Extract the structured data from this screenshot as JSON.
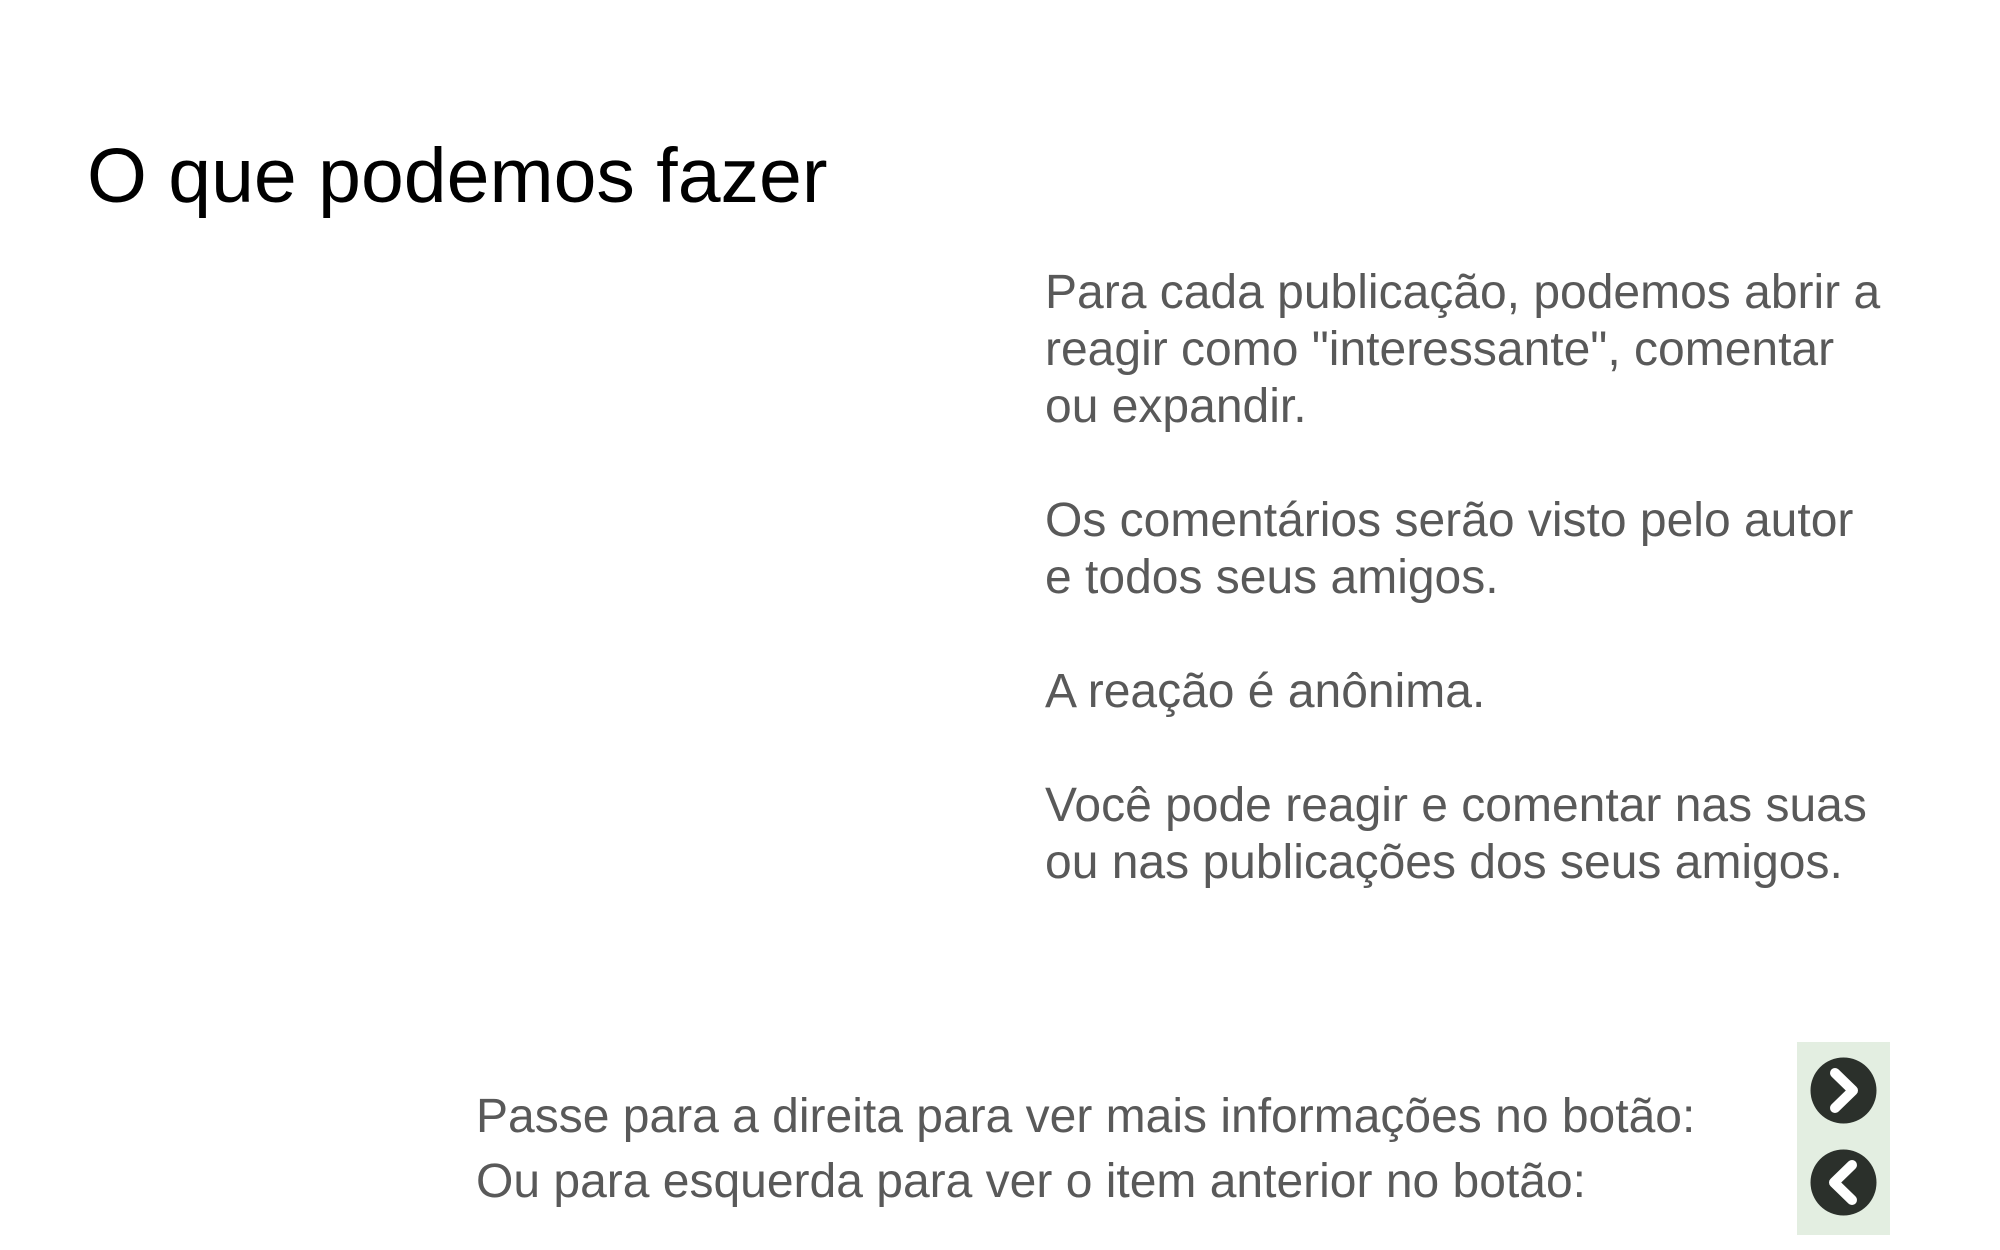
{
  "slide": {
    "title": "O que podemos fazer",
    "paragraphs": [
      [
        "Para cada publicação, podemos abrir a",
        "reagir como \"interessante\", comentar",
        "ou expandir."
      ],
      [
        "Os comentários serão visto pelo autor",
        "e todos seus amigos."
      ],
      [
        "A reação é anônima."
      ],
      [
        "Você pode reagir e comentar nas suas",
        "ou nas publicações dos seus amigos."
      ]
    ],
    "navigation": {
      "next_text": "Passe para a direita para ver mais informações no botão:",
      "prev_text": "Ou para esquerda para ver o item anterior no botão:",
      "next_icon": "chevron-right-circle-icon",
      "prev_icon": "chevron-left-circle-icon"
    }
  },
  "colors": {
    "title": "#000000",
    "body_text": "#595959",
    "nav_panel_bg": "#e3eee1",
    "nav_icon": "#2b302b"
  }
}
